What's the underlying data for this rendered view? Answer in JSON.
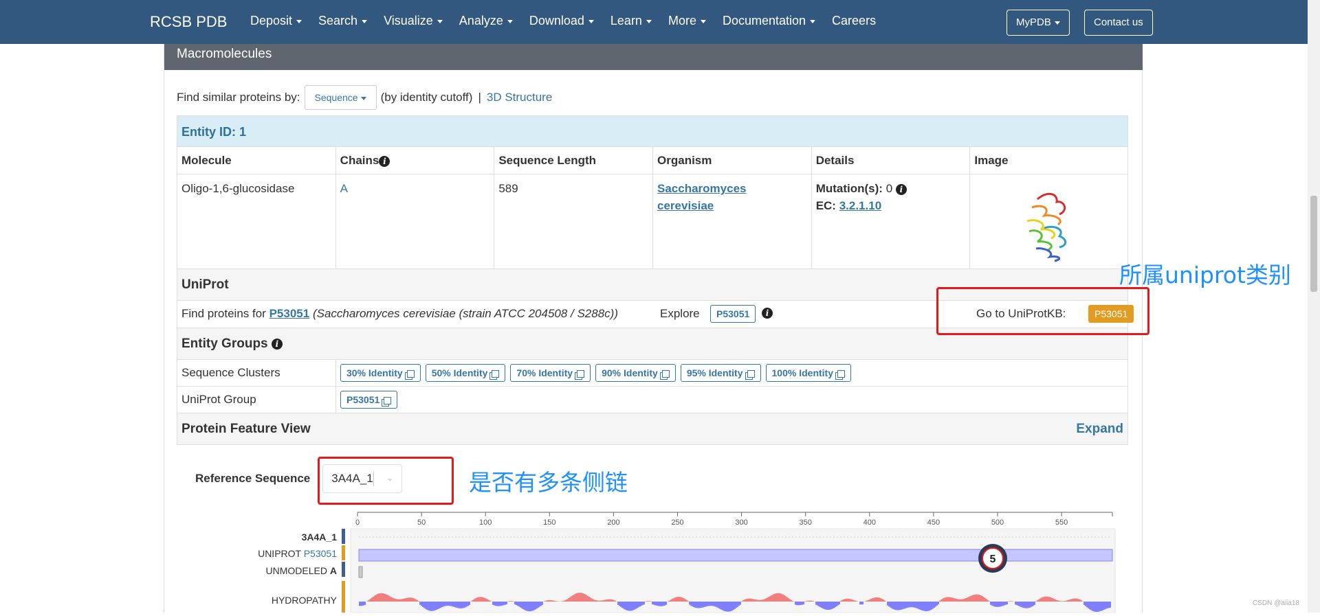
{
  "navbar": {
    "brand": "RCSB PDB",
    "items": [
      "Deposit",
      "Search",
      "Visualize",
      "Analyze",
      "Download",
      "Learn",
      "More",
      "Documentation",
      "Careers"
    ],
    "mypdb": "MyPDB",
    "contact": "Contact us"
  },
  "panel": {
    "title": "Macromolecules",
    "find_label": "Find similar proteins by:",
    "find_select": "Sequence",
    "find_suffix": "(by identity cutoff)",
    "find_sep": "|",
    "find_3d": "3D Structure"
  },
  "entity": {
    "title": "Entity ID: 1",
    "columns": [
      "Molecule",
      "Chains",
      "Sequence Length",
      "Organism",
      "Details",
      "Image"
    ],
    "molecule": "Oligo-1,6-glucosidase",
    "chains": "A",
    "length": "589",
    "organism_1": "Saccharomyces",
    "organism_2": "cerevisiae",
    "mutation_label": "Mutation(s):",
    "mutation_value": "0",
    "ec_label": "EC:",
    "ec_value": "3.2.1.10"
  },
  "uniprot": {
    "title": "UniProt",
    "find_prefix": "Find proteins for",
    "accession": "P53051",
    "organism": "(Saccharomyces cerevisiae (strain ATCC 204508 / S288c))",
    "explore": "Explore",
    "explore_acc": "P53051",
    "goto": "Go to UniProtKB:",
    "goto_acc": "P53051"
  },
  "groups": {
    "title": "Entity Groups",
    "seq_clusters_label": "Sequence Clusters",
    "clusters": [
      "30% Identity",
      "50% Identity",
      "70% Identity",
      "90% Identity",
      "95% Identity",
      "100% Identity"
    ],
    "uniprot_group_label": "UniProt Group",
    "uniprot_group": "P53051"
  },
  "pfv": {
    "title": "Protein Feature View",
    "expand": "Expand",
    "ref_label": "Reference Sequence",
    "ref_value": "3A4A_1",
    "ticks": [
      "0",
      "50",
      "100",
      "150",
      "200",
      "250",
      "300",
      "350",
      "400",
      "450",
      "500",
      "550"
    ],
    "tracks": {
      "seq": "3A4A_1",
      "uniprot_prefix": "UNIPROT",
      "uniprot_acc": "P53051",
      "unmodeled_prefix": "UNMODELED",
      "unmodeled_chain": "A",
      "hydropathy": "HYDROPATHY"
    },
    "badge": "5"
  },
  "annotations": {
    "uniprot_note": "所属uniprot类别",
    "chain_note": "是否有多条侧链"
  },
  "watermark": "CSDN @aiia18"
}
